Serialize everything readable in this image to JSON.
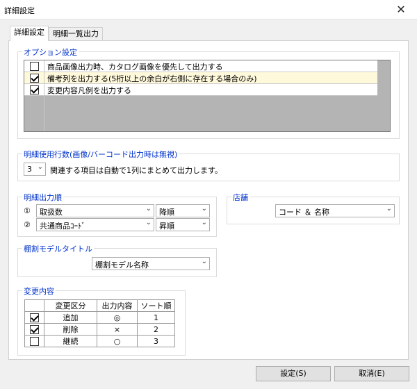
{
  "window": {
    "title": "詳細設定",
    "close_glyph": "✕"
  },
  "tabs": [
    {
      "label": "詳細設定"
    },
    {
      "label": "明細一覧出力"
    }
  ],
  "options": {
    "title": "オプション設定",
    "items": [
      {
        "label": "商品画像出力時、カタログ画像を優先して出力する",
        "checked": false
      },
      {
        "label": "備考列を出力する(5桁以上の余白が右側に存在する場合のみ)",
        "checked": true
      },
      {
        "label": "変更内容凡例を出力する",
        "checked": true
      }
    ]
  },
  "rows_setting": {
    "title": "明細使用行数(画像/バーコード出力時は無視)",
    "value": "3",
    "note": "関連する項目は自動で1列にまとめて出力します。"
  },
  "order": {
    "title": "明細出力順",
    "rows": [
      {
        "marker": "①",
        "field": "取扱数",
        "direction": "降順"
      },
      {
        "marker": "②",
        "field": "共通商品ｺｰﾄﾞ",
        "direction": "昇順"
      }
    ]
  },
  "store": {
    "title": "店舗",
    "value": "コード ＆ 名称"
  },
  "model_title": {
    "title": "棚割モデルタイトル",
    "value": "棚割モデル名称"
  },
  "changes": {
    "title": "変更内容",
    "headers": [
      "変更区分",
      "出力内容",
      "ソート順"
    ],
    "rows": [
      {
        "checked": true,
        "category": "追加",
        "symbol": "◎",
        "sort": "1"
      },
      {
        "checked": true,
        "category": "削除",
        "symbol": "×",
        "sort": "2"
      },
      {
        "checked": false,
        "category": "継続",
        "symbol": "○",
        "sort": "3"
      }
    ]
  },
  "footer": {
    "ok_label": "設定(S)",
    "cancel_label": "取消(E)"
  }
}
